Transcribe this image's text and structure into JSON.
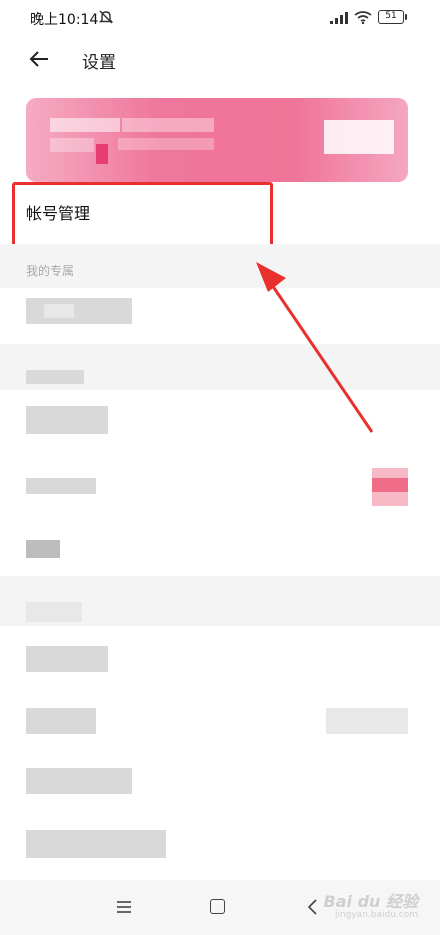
{
  "status_bar": {
    "time": "晚上10:14",
    "battery": "51",
    "icons": [
      "bell-off-icon",
      "signal-icon",
      "wifi-icon",
      "battery-icon"
    ]
  },
  "header": {
    "title": "设置",
    "back_icon": "arrow-left-icon"
  },
  "account": {
    "label": "帐号管理"
  },
  "sections": {
    "exclusive_label": "我的专属"
  },
  "nav_bar": {
    "watermark": "Bai du 经验",
    "watermark_sub": "jingyan.baidu.com",
    "icons": [
      "menu-icon",
      "home-icon",
      "back-icon"
    ]
  },
  "colors": {
    "annotation_red": "#e8312f",
    "brand_pink": "#ef6f97"
  }
}
